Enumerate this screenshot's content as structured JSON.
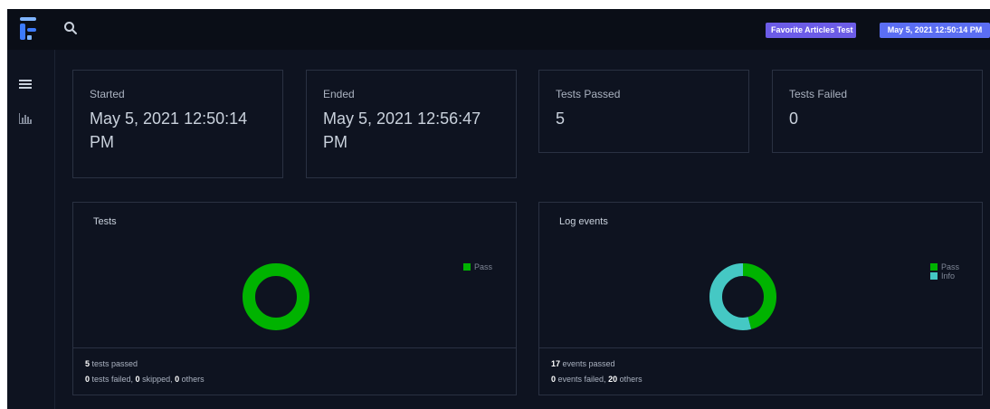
{
  "topbar": {
    "suite_tag": "Favorite Articles Test",
    "date_tag": "May 5, 2021 12:50:14 PM"
  },
  "sidebar": {
    "items": [
      {
        "icon": "list-icon"
      },
      {
        "icon": "bar-chart-icon"
      }
    ]
  },
  "summary": {
    "started": {
      "label": "Started",
      "value": "May 5, 2021 12:50:14 PM"
    },
    "ended": {
      "label": "Ended",
      "value": "May 5, 2021 12:56:47 PM"
    },
    "passed": {
      "label": "Tests Passed",
      "value": "5"
    },
    "failed": {
      "label": "Tests Failed",
      "value": "0"
    }
  },
  "tests_panel": {
    "title": "Tests",
    "legend": [
      {
        "label": "Pass",
        "color": "#00b300"
      }
    ],
    "footer": {
      "passed_count": "5",
      "passed_text": " tests passed",
      "failed_count": "0",
      "failed_text": " tests failed, ",
      "skipped_count": "0",
      "skipped_text": " skipped, ",
      "others_count": "0",
      "others_text": " others"
    }
  },
  "log_panel": {
    "title": "Log events",
    "legend": [
      {
        "label": "Pass",
        "color": "#00b300"
      },
      {
        "label": "Info",
        "color": "#45c8c4"
      }
    ],
    "footer": {
      "passed_count": "17",
      "passed_text": " events passed",
      "failed_count": "0",
      "failed_text": " events failed, ",
      "others_count": "20",
      "others_text": " others"
    }
  },
  "chart_data": [
    {
      "type": "pie",
      "title": "Tests",
      "categories": [
        "Pass"
      ],
      "values": [
        5
      ],
      "colors": [
        "#00b300"
      ]
    },
    {
      "type": "pie",
      "title": "Log events",
      "categories": [
        "Pass",
        "Info"
      ],
      "values": [
        17,
        20
      ],
      "colors": [
        "#00b300",
        "#45c8c4"
      ]
    }
  ]
}
